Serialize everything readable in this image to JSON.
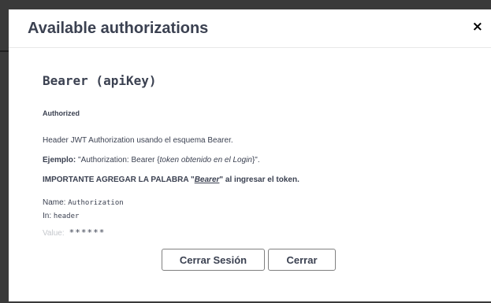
{
  "modal": {
    "title": "Available authorizations",
    "close_glyph": "×"
  },
  "scheme": {
    "title": "Bearer  (apiKey)",
    "status": "Authorized",
    "description": "Header JWT Authorization usando el esquema Bearer.",
    "example_label": "Ejemplo:",
    "example_prefix": " \"Authorization: Bearer {",
    "example_italic": "token obtenido en el Login",
    "example_suffix": "}\".",
    "important_prefix": "IMPORTANTE AGREGAR LA PALABRA \"",
    "important_word": "Bearer",
    "important_suffix": "\" al ingresar el token.",
    "name_label": "Name:",
    "name_value": "Authorization",
    "in_label": "In:",
    "in_value": "header",
    "value_label": "Value:",
    "value_mask": "******"
  },
  "buttons": {
    "logout_label": "Cerrar Sesión",
    "close_label": "Cerrar"
  }
}
